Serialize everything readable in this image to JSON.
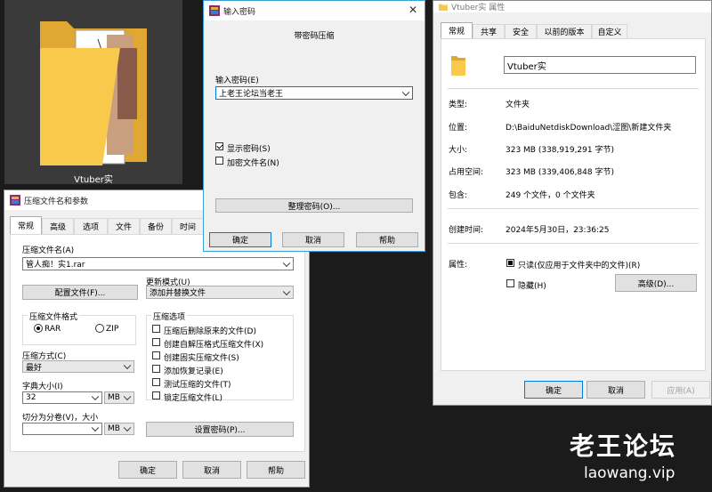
{
  "desktop": {
    "folder_label": "Vtuber实"
  },
  "archive_dialog": {
    "title": "压缩文件名和参数",
    "tabs": [
      "常规",
      "高级",
      "选项",
      "文件",
      "备份",
      "时间"
    ],
    "archive_name_label": "压缩文件名(A)",
    "archive_name_value": "管人痴！实1.rar",
    "profiles_button": "配置文件(F)...",
    "update_mode_label": "更新模式(U)",
    "update_mode_value": "添加并替换文件",
    "format_group_label": "压缩文件格式",
    "format_rar": "RAR",
    "format_zip": "ZIP",
    "options_group_label": "压缩选项",
    "options": [
      {
        "label": "压缩后删除原来的文件(D)",
        "checked": false
      },
      {
        "label": "创建自解压格式压缩文件(X)",
        "checked": false
      },
      {
        "label": "创建固实压缩文件(S)",
        "checked": false
      },
      {
        "label": "添加恢复记录(E)",
        "checked": false
      },
      {
        "label": "测试压缩的文件(T)",
        "checked": false
      },
      {
        "label": "锁定压缩文件(L)",
        "checked": false
      }
    ],
    "method_label": "压缩方式(C)",
    "method_value": "最好",
    "dict_label": "字典大小(I)",
    "dict_value": "32",
    "dict_unit": "MB",
    "split_label": "切分为分卷(V)，大小",
    "split_value": "",
    "split_unit": "MB",
    "set_password_button": "设置密码(P)...",
    "ok": "确定",
    "cancel": "取消",
    "help": "帮助"
  },
  "password_dialog": {
    "title": "输入密码",
    "heading": "带密码压缩",
    "password_label": "输入密码(E)",
    "password_value": "上老王论坛当老王",
    "show_password": "显示密码(S)",
    "show_password_checked": true,
    "encrypt_names": "加密文件名(N)",
    "encrypt_names_checked": false,
    "organize_button": "整理密码(O)...",
    "ok": "确定",
    "cancel": "取消",
    "help": "帮助"
  },
  "properties_dialog": {
    "title": "Vtuber实 属性",
    "tabs": [
      "常规",
      "共享",
      "安全",
      "以前的版本",
      "自定义"
    ],
    "name_value": "Vtuber实",
    "type_label": "类型:",
    "type_value": "文件夹",
    "location_label": "位置:",
    "location_value": "D:\\BaiduNetdiskDownload\\涩图\\新建文件夹",
    "size_label": "大小:",
    "size_value": "323 MB (338,919,291 字节)",
    "disk_label": "占用空间:",
    "disk_value": "323 MB (339,406,848 字节)",
    "contains_label": "包含:",
    "contains_value": "249 个文件，0 个文件夹",
    "created_label": "创建时间:",
    "created_value": "2024年5月30日，23:36:25",
    "attributes_label": "属性:",
    "readonly_label": "只读(仅应用于文件夹中的文件)(R)",
    "hidden_label": "隐藏(H)",
    "advanced_button": "高级(D)...",
    "ok": "确定",
    "cancel": "取消",
    "apply": "应用(A)"
  },
  "watermark": {
    "title": "老王论坛",
    "url": "laowang.vip"
  },
  "colors": {
    "accent": "#0078d7",
    "folder": "#f8c94a",
    "desktop_bg": "#1b1b1b"
  }
}
